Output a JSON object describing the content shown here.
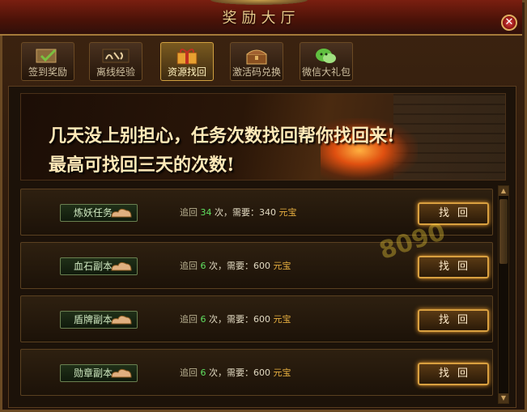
{
  "window": {
    "title": "奖励大厅",
    "close_icon": "close-icon"
  },
  "tabs": [
    {
      "label": "签到奖励",
      "icon": "scroll-check-icon",
      "active": false
    },
    {
      "label": "离线经验",
      "icon": "calligraphy-icon",
      "active": false
    },
    {
      "label": "资源找回",
      "icon": "gift-box-icon",
      "active": true
    },
    {
      "label": "激活码兑换",
      "icon": "treasure-chest-icon",
      "active": false
    },
    {
      "label": "微信大礼包",
      "icon": "wechat-icon",
      "active": false
    }
  ],
  "banner": {
    "line1": "几天没上别担心，任务次数找回帮你找回来!",
    "line2": "最高可找回三天的次数!"
  },
  "rows": [
    {
      "task": "炼妖任务",
      "prefix": "追回",
      "count": "34",
      "unit_text": "次，需要：",
      "cost": "340",
      "currency": "元宝",
      "button": "找回"
    },
    {
      "task": "血石副本",
      "prefix": "追回",
      "count": "6",
      "unit_text": "次，需要：",
      "cost": "600",
      "currency": "元宝",
      "button": "找回"
    },
    {
      "task": "盾牌副本",
      "prefix": "追回",
      "count": "6",
      "unit_text": "次，需要：",
      "cost": "600",
      "currency": "元宝",
      "button": "找回"
    },
    {
      "task": "勋章副本",
      "prefix": "追回",
      "count": "6",
      "unit_text": "次，需要：",
      "cost": "600",
      "currency": "元宝",
      "button": "找回"
    }
  ],
  "watermark": "8090",
  "colors": {
    "accent_gold": "#d9a040",
    "count_green": "#60e060",
    "currency": "#e8b040"
  }
}
